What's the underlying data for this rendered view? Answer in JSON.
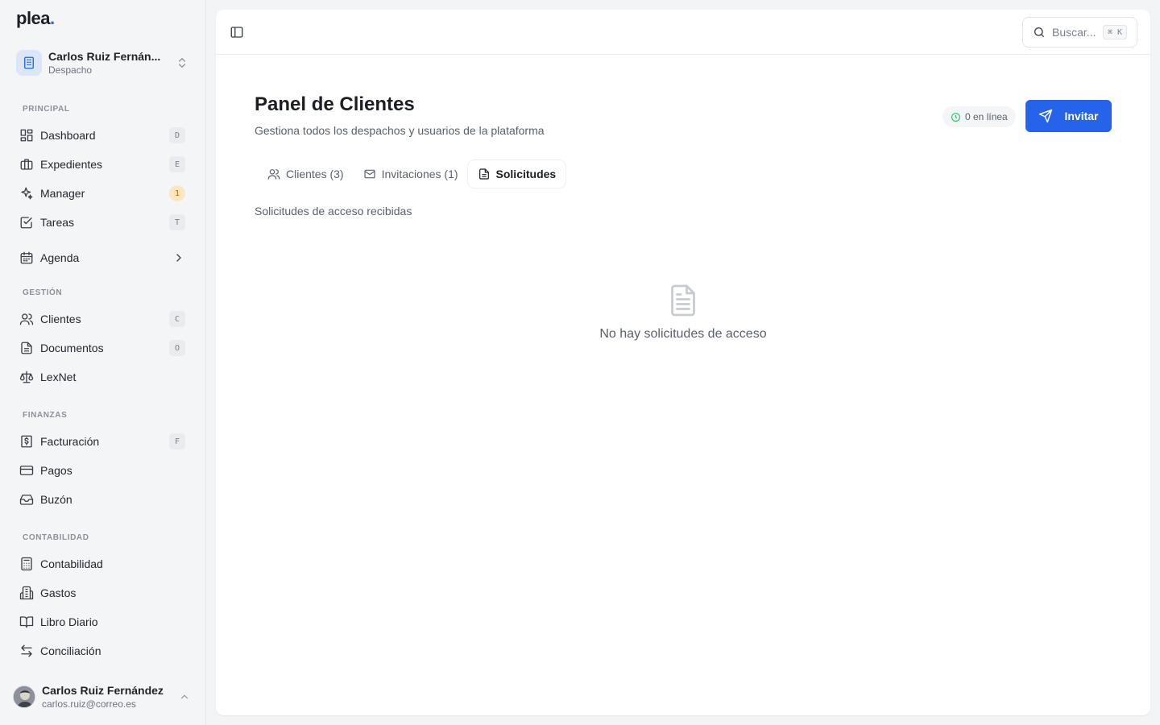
{
  "brand": {
    "name": "plea",
    "dot": "."
  },
  "workspace": {
    "name": "Carlos Ruiz Fernán...",
    "type": "Despacho"
  },
  "sidebar": {
    "sections": [
      {
        "label": "PRINCIPAL"
      },
      {
        "label": "GESTIÓN"
      },
      {
        "label": "FINANZAS"
      },
      {
        "label": "CONTABILIDAD"
      }
    ],
    "items": [
      {
        "label": "Dashboard",
        "shortcut": "D",
        "icon": "dashboard-icon"
      },
      {
        "label": "Expedientes",
        "shortcut": "E",
        "icon": "briefcase-icon"
      },
      {
        "label": "Manager",
        "badge": "1",
        "icon": "sparkles-icon"
      },
      {
        "label": "Tareas",
        "shortcut": "T",
        "icon": "check-square-icon"
      },
      {
        "label": "Agenda",
        "icon": "calendar-icon"
      },
      {
        "label": "Clientes",
        "shortcut": "C",
        "icon": "users-icon"
      },
      {
        "label": "Documentos",
        "shortcut": "O",
        "icon": "document-icon"
      },
      {
        "label": "LexNet",
        "icon": "scale-icon"
      },
      {
        "label": "Facturación",
        "shortcut": "F",
        "icon": "receipt-icon"
      },
      {
        "label": "Pagos",
        "icon": "credit-card-icon"
      },
      {
        "label": "Buzón",
        "icon": "inbox-icon"
      },
      {
        "label": "Contabilidad",
        "icon": "calculator-icon"
      },
      {
        "label": "Gastos",
        "icon": "building-icon"
      },
      {
        "label": "Libro Diario",
        "icon": "book-icon"
      },
      {
        "label": "Conciliación",
        "icon": "arrows-icon"
      }
    ]
  },
  "user": {
    "name": "Carlos Ruiz Fernández",
    "email": "carlos.ruiz@correo.es"
  },
  "topbar": {
    "search_placeholder": "Buscar...",
    "search_shortcut": "⌘ K"
  },
  "page": {
    "title": "Panel de Clientes",
    "subtitle": "Gestiona todos los despachos y usuarios de la plataforma",
    "online": "0 en línea",
    "invite_label": "Invitar",
    "tabs": [
      {
        "label": "Clientes (3)"
      },
      {
        "label": "Invitaciones (1)"
      },
      {
        "label": "Solicitudes"
      }
    ],
    "section_desc": "Solicitudes de acceso recibidas",
    "empty_text": "No hay solicitudes de acceso"
  },
  "colors": {
    "accent": "#2563eb",
    "badge_bg": "#fde7c2",
    "badge_fg": "#b86b00",
    "online": "#22c55e"
  }
}
